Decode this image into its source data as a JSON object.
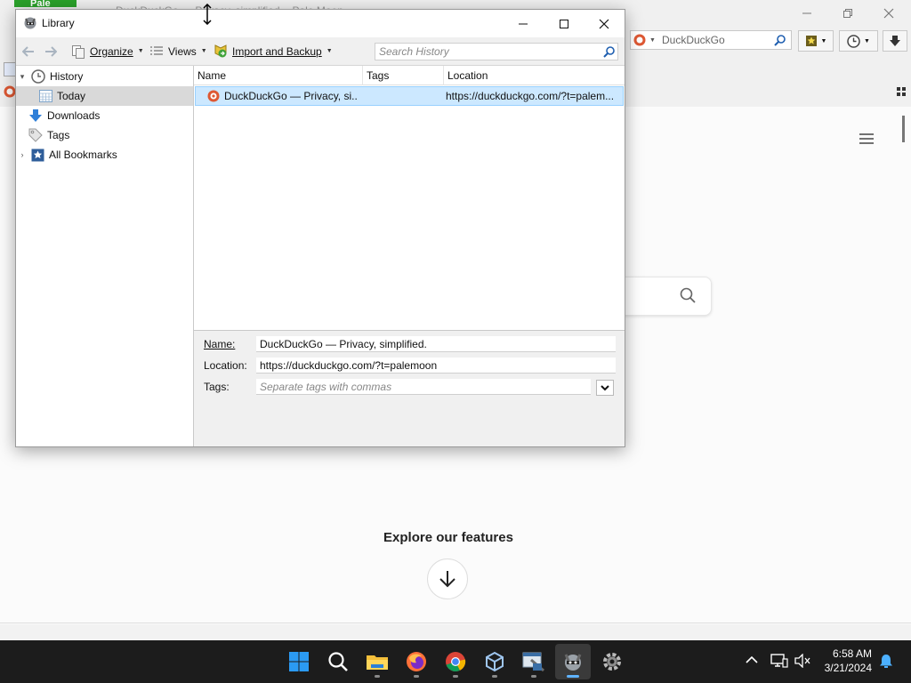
{
  "browser": {
    "menu_button_label": "Pale Moon ▾",
    "background_title": "DuckDuckGo — Privacy, simplified. - Pale Moon",
    "search_engine_text": "DuckDuckGo",
    "page_heading": "Explore our features"
  },
  "library": {
    "title": "Library",
    "toolbar": {
      "organize_label": "Organize",
      "views_label": "Views",
      "import_label": "Import and Backup",
      "search_placeholder": "Search History"
    },
    "tree": [
      {
        "label": "History",
        "icon": "clock-icon",
        "expanded": true
      },
      {
        "label": "Today",
        "icon": "calendar-icon",
        "selected": true
      },
      {
        "label": "Downloads",
        "icon": "download-arrow-icon"
      },
      {
        "label": "Tags",
        "icon": "tag-icon"
      },
      {
        "label": "All Bookmarks",
        "icon": "bookmark-star-icon",
        "expanded": false
      }
    ],
    "columns": [
      "Name",
      "Tags",
      "Location"
    ],
    "rows": [
      {
        "name": "DuckDuckGo — Privacy, si...",
        "tags": "",
        "location": "https://duckduckgo.com/?t=palem..."
      }
    ],
    "details": {
      "name_label": "Name:",
      "name_value": "DuckDuckGo — Privacy, simplified.",
      "location_label": "Location:",
      "location_value": "https://duckduckgo.com/?t=palemoon",
      "tags_label": "Tags:",
      "tags_placeholder": "Separate tags with commas"
    }
  },
  "taskbar": {
    "apps": [
      "start-icon",
      "search-icon",
      "file-explorer-icon",
      "firefox-icon",
      "chrome-icon",
      "virtualbox-icon",
      "tool-icon",
      "palemoon-icon",
      "settings-icon"
    ],
    "time": "6:58 AM",
    "date": "3/21/2024"
  },
  "colors": {
    "selection_bg": "#cce8ff",
    "selection_border": "#99d1ff",
    "taskbar_bg": "#1c1c1c",
    "palemoon_green": "#2aa12a"
  }
}
